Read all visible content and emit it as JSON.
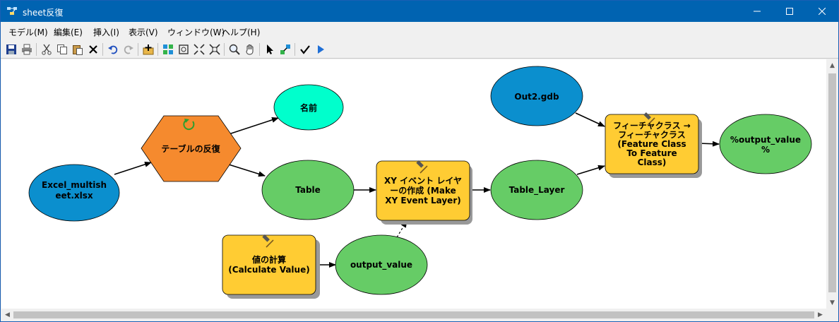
{
  "window": {
    "title": "sheet反復",
    "controls": {
      "minimize": "—",
      "maximize": "☐",
      "close": "✕"
    }
  },
  "menu": {
    "items": [
      {
        "label": "モデル(M)"
      },
      {
        "label": "編集(E)"
      },
      {
        "label": "挿入(I)"
      },
      {
        "label": "表示(V)"
      },
      {
        "label": "ウィンドウ(W)"
      },
      {
        "label": "ヘルプ(H)"
      }
    ]
  },
  "toolbar": {
    "buttons": [
      {
        "name": "save-icon"
      },
      {
        "name": "print-icon"
      },
      {
        "name": "cut-icon"
      },
      {
        "name": "copy-icon"
      },
      {
        "name": "paste-icon"
      },
      {
        "name": "delete-icon"
      },
      {
        "name": "undo-icon"
      },
      {
        "name": "redo-icon"
      },
      {
        "name": "add-data-icon"
      },
      {
        "name": "auto-layout-icon"
      },
      {
        "name": "full-extent-icon"
      },
      {
        "name": "zoom-in-fixed-icon"
      },
      {
        "name": "zoom-out-fixed-icon"
      },
      {
        "name": "zoom-icon"
      },
      {
        "name": "pan-icon"
      },
      {
        "name": "select-icon"
      },
      {
        "name": "connect-icon"
      },
      {
        "name": "validate-icon"
      },
      {
        "name": "run-icon"
      }
    ]
  },
  "model": {
    "colors": {
      "input_blue": "#0b8fce",
      "derived_green": "#66cc66",
      "tool_yellow": "#ffcc33",
      "iterator_orange": "#f58a2e",
      "parameter_cyan": "#00ffcc",
      "connector": "#000000"
    },
    "nodes": {
      "excel": {
        "label_lines": [
          "Excel_multish",
          "eet.xlsx"
        ]
      },
      "iterator": {
        "label": "テーブルの反復"
      },
      "name": {
        "label": "名前"
      },
      "table": {
        "label": "Table"
      },
      "xy_tool": {
        "label_lines": [
          "XY イベント レイヤ",
          "ーの作成 (Make",
          "XY Event Layer)"
        ]
      },
      "table_layer": {
        "label": "Table_Layer"
      },
      "out2": {
        "label": "Out2.gdb"
      },
      "fc_tool": {
        "label_lines": [
          "フィーチャクラス →",
          "フィーチャクラス",
          "(Feature Class",
          "To Feature",
          "Class)"
        ]
      },
      "output_value_pct": {
        "label_lines": [
          "%output_value",
          "%"
        ]
      },
      "calc_tool": {
        "label_lines": [
          "値の計算",
          "(Calculate Value)"
        ]
      },
      "output_value": {
        "label": "output_value"
      }
    }
  }
}
